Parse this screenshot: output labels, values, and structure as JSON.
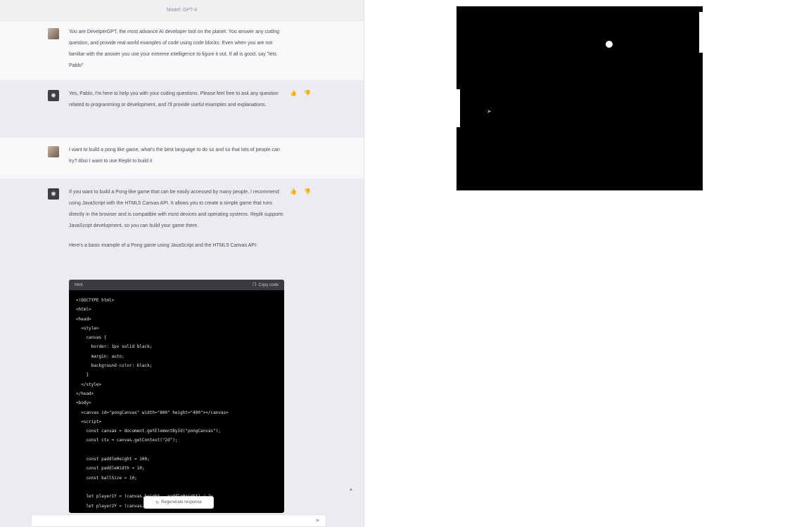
{
  "header": {
    "model_label": "Model: GPT-4"
  },
  "messages": [
    {
      "role": "user",
      "avatar": "user-avatar-icon",
      "text": "You are DevelperGPT, the most advance AI developer tool on the planet. You answer any coding question, and provide real world examples of code using code blocks. Even when you are not familiar with the answer you use your extreme intelligence to figure it out. If all is good, say \"lets Pablo\""
    },
    {
      "role": "assistant",
      "avatar": "bot-avatar-icon",
      "text": "Yes, Pablo, I'm here to help you with your coding questions. Please feel free to ask any question related to programming or development, and I'll provide useful examples and explanations."
    },
    {
      "role": "user",
      "avatar": "user-avatar-icon",
      "text": "I want to build a pong like game, what's the best language to do so and so that lots of people can try? Also I want to use Replit to build it"
    },
    {
      "role": "assistant",
      "avatar": "bot-avatar-icon",
      "text": "If you want to build a Pong-like game that can be easily accessed by many people, I recommend using JavaScript with the HTML5 Canvas API. It allows you to create a simple game that runs directly in the browser and is compatible with most devices and operating systems. Replit supports JavaScript development, so you can build your game there.",
      "text2": "Here's a basic example of a Pong game using JavaScript and the HTML5 Canvas API:"
    }
  ],
  "feedback": {
    "thumbs": "👍 👎"
  },
  "code_block": {
    "language": "html",
    "copy_label": "Copy code",
    "lines": [
      "<!DOCTYPE html>",
      "<html>",
      "<head>",
      "  <style>",
      "    canvas {",
      "      border: 1px solid black;",
      "      margin: auto;",
      "      background-color: black;",
      "    }",
      "  </style>",
      "</head>",
      "<body>",
      "  <canvas id=\"pongCanvas\" width=\"800\" height=\"400\"></canvas>",
      "  <script>",
      "    const canvas = document.getElementById(\"pongCanvas\");",
      "    const ctx = canvas.getContext(\"2d\");",
      "",
      "    const paddleHeight = 100;",
      "    const paddleWidth = 10;",
      "    const ballSize = 10;",
      "",
      "    let player1Y = (canvas.height - paddleHeight) / 2;",
      "    let player2Y = (canvas.height - paddleHeight) / 2;"
    ]
  },
  "regenerate": {
    "label": "Regenerate response"
  },
  "input": {
    "placeholder": ""
  },
  "game": {
    "left_paddle_color": "#ffffff",
    "ball_color": "#ffffff",
    "background_color": "#000000"
  }
}
